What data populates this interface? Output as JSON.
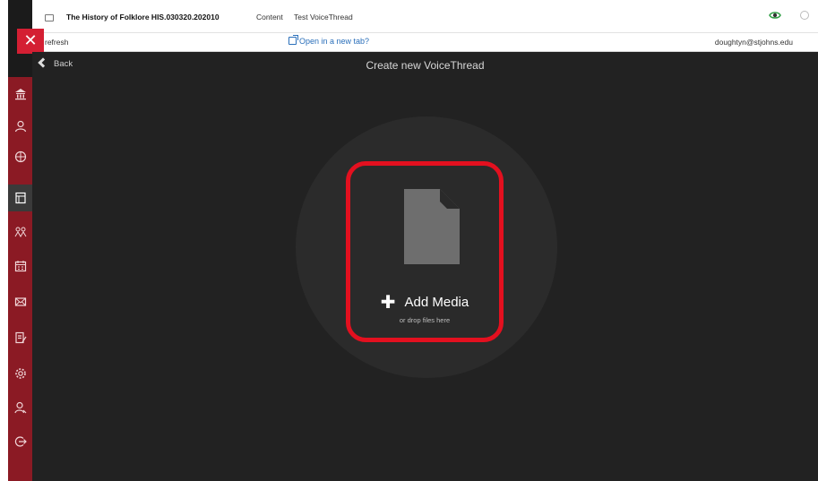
{
  "header": {
    "course_title": "The History of Folklore HIS.030320.202010",
    "crumb_content": "Content",
    "crumb_page": "Test VoiceThread"
  },
  "subbar": {
    "refresh_label": "refresh",
    "new_tab_label": "Open in a new tab?",
    "user_email": "doughtyn@stjohns.edu"
  },
  "stage": {
    "back_label": "Back",
    "heading": "Create new VoiceThread",
    "add_media_label": "Add Media",
    "drop_hint": "or drop files here"
  },
  "nav": {
    "close_label": "✕"
  },
  "colors": {
    "nav_red": "#8b1a24",
    "highlight_red": "#e3101f",
    "stage_bg": "#222222"
  }
}
